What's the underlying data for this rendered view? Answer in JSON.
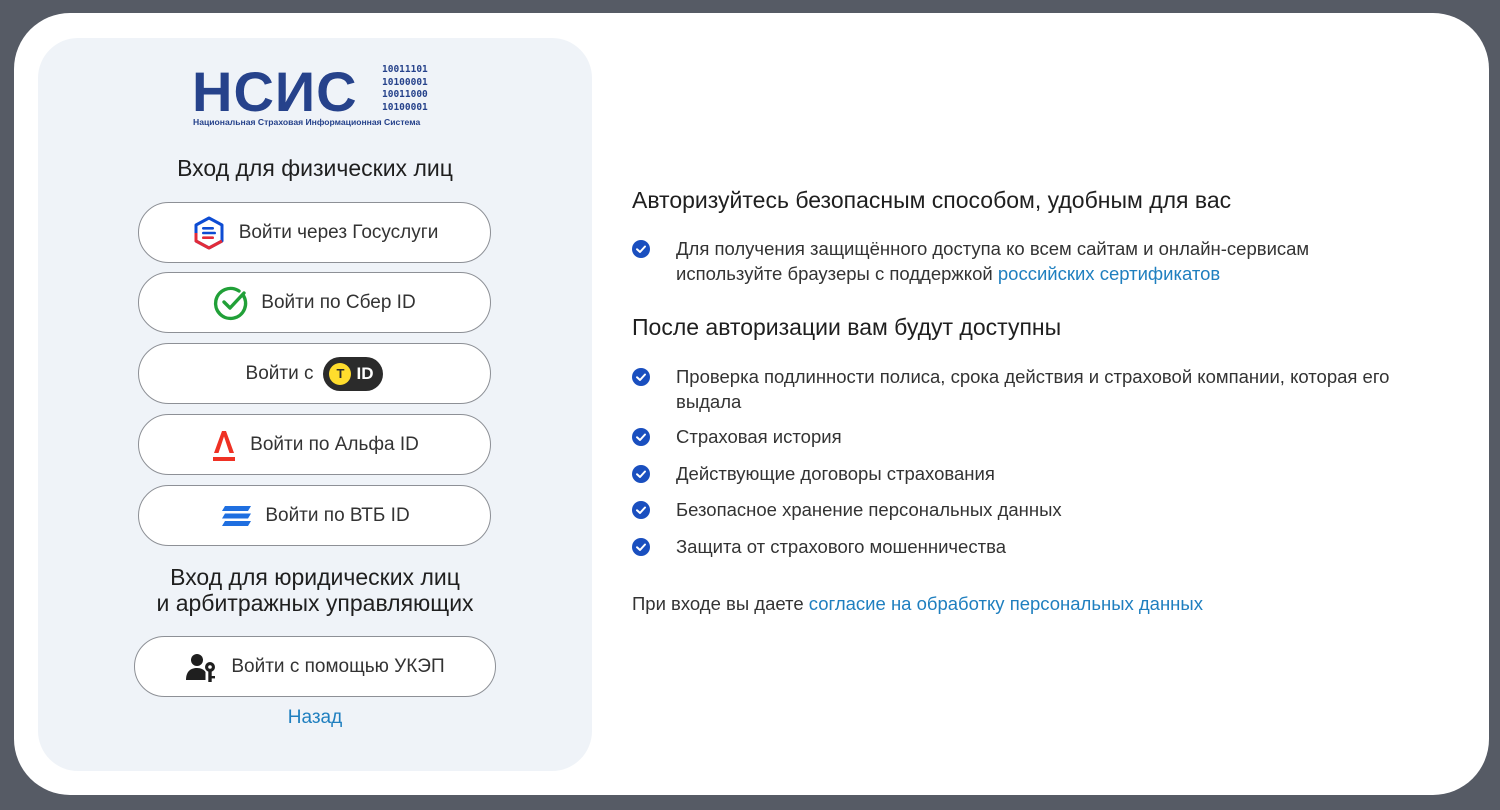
{
  "logo": {
    "name": "НСИС",
    "binary": [
      "10011101",
      "10100001",
      "10011000",
      "10100001"
    ],
    "subtitle": "Национальная Страховая Информационная Система",
    "color": "#26428b"
  },
  "individuals": {
    "title": "Вход для физических лиц",
    "buttons": {
      "gosuslugi": "Войти через Госуслуги",
      "sber": "Войти по Сбер ID",
      "tid_prefix": "Войти с",
      "tid_badge": "ID",
      "alfa": "Войти по Альфа ID",
      "vtb": "Войти по ВТБ ID"
    }
  },
  "legal": {
    "title_line1": "Вход для юридических лиц",
    "title_line2": "и арбитражных управляющих",
    "ukep_button": "Войти с помощью УКЭП"
  },
  "back_link": "Назад",
  "info": {
    "heading1": "Авторизуйтесь безопасным способом, удобным для вас",
    "browser_note_line1": "Для получения защищённого доступа ко всем сайтам и онлайн-сервисам",
    "browser_note_line2_prefix": "используйте браузеры с поддержкой ",
    "browser_note_link": "российских сертификатов",
    "heading2": "После авторизации вам будут доступны",
    "features": [
      "Проверка подлинности полиса, срока действия и страховой компании, которая его выдала",
      "Страховая история",
      "Действующие договоры страхования",
      "Безопасное хранение персональных данных",
      "Защита от страхового мошенничества"
    ],
    "consent_prefix": "При входе вы даете ",
    "consent_link": "согласие на обработку персональных данных"
  },
  "colors": {
    "background": "#565b65",
    "panel": "#eff3f8",
    "link": "#1f7fbf",
    "check": "#1a4fbf"
  }
}
